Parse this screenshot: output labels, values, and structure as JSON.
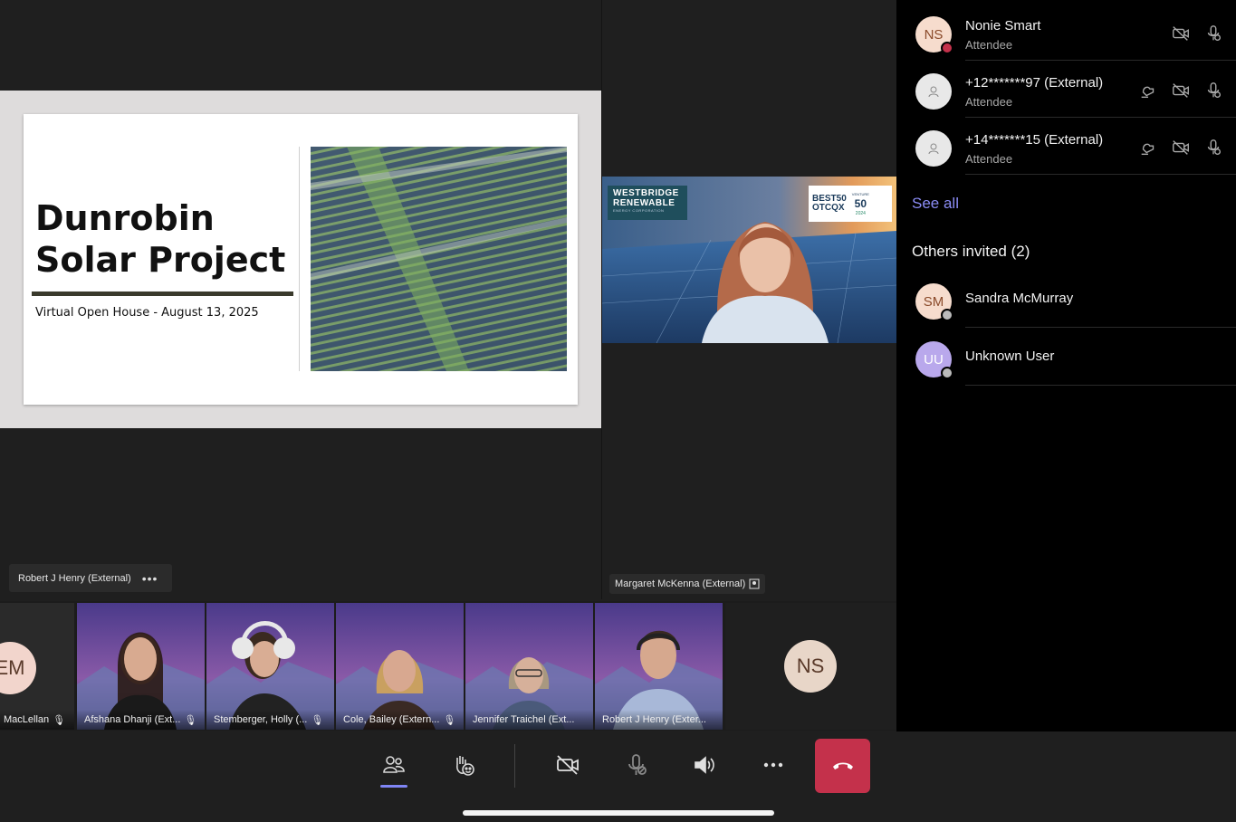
{
  "slide": {
    "title_line1": "Dunrobin",
    "title_line2": "Solar Project",
    "subtitle": "Virtual Open House - August 13, 2025"
  },
  "presenter_label": "Robert J Henry (External)",
  "speaker": {
    "label": "Margaret McKenna (External)",
    "logo_line1": "WESTBRIDGE",
    "logo_line2": "RENEWABLE",
    "logo_line3": "ENERGY CORPORATION",
    "badge1_line1": "BEST50",
    "badge1_line2": "OTCQX",
    "badge2_top": "VENTURE",
    "badge2_num": "50",
    "badge2_year": "2024"
  },
  "filmstrip": [
    {
      "name": "MacLellan",
      "initials": "EM"
    },
    {
      "name": "Afshana Dhanji (Ext..."
    },
    {
      "name": "Stemberger, Holly (..."
    },
    {
      "name": "Cole, Bailey (Extern..."
    },
    {
      "name": "Jennifer Traichel (Ext..."
    },
    {
      "name": "Robert J Henry (Exter..."
    },
    {
      "initials": "NS"
    }
  ],
  "panel": {
    "attendees": [
      {
        "initials": "NS",
        "name": "Nonie Smart",
        "role": "Attendee"
      },
      {
        "initials": "",
        "name": "+12*******97 (External)",
        "role": "Attendee"
      },
      {
        "initials": "",
        "name": "+14*******15 (External)",
        "role": "Attendee"
      }
    ],
    "see_all": "See all",
    "others_title": "Others invited (2)",
    "invited": [
      {
        "initials": "SM",
        "name": "Sandra McMurray"
      },
      {
        "initials": "UU",
        "name": "Unknown User"
      }
    ]
  },
  "colors": {
    "accent": "#7f85f5",
    "hangup": "#c4314b",
    "link": "#8b8cf5"
  }
}
